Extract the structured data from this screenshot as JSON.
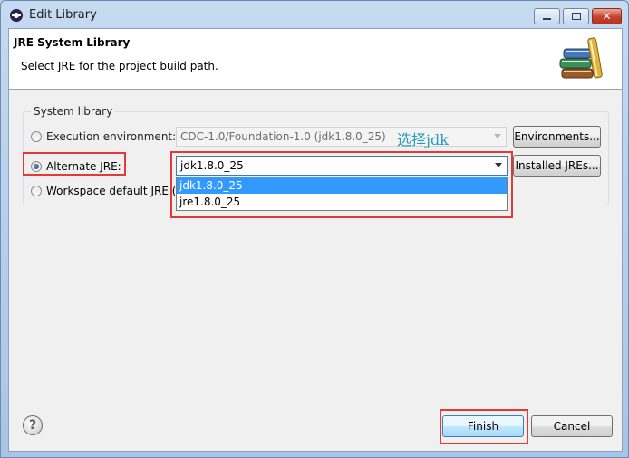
{
  "window": {
    "title": "Edit Library",
    "minimize": "minimize",
    "maximize": "maximize",
    "close_glyph": "✕"
  },
  "header": {
    "title": "JRE System Library",
    "description": "Select JRE for the project build path."
  },
  "group": {
    "legend": "System library",
    "execution_env": {
      "label": "Execution environment:",
      "value": "CDC-1.0/Foundation-1.0 (jdk1.8.0_25)",
      "checked": false,
      "button": "Environments..."
    },
    "alternate_jre": {
      "label": "Alternate JRE:",
      "value": "jdk1.8.0_25",
      "checked": true,
      "button": "Installed JREs..."
    },
    "workspace_default": {
      "label": "Workspace default JRE (",
      "checked": false
    }
  },
  "dropdown": {
    "options": [
      "jdk1.8.0_25",
      "jre1.8.0_25"
    ],
    "selected_index": 0
  },
  "annotation": {
    "text": "选择jdk",
    "color": "#e53935"
  },
  "footer": {
    "help_glyph": "?",
    "finish": "Finish",
    "cancel": "Cancel"
  },
  "icons": {
    "app": "eclipse-icon",
    "banner": "library-books-icon",
    "help": "help-icon"
  }
}
